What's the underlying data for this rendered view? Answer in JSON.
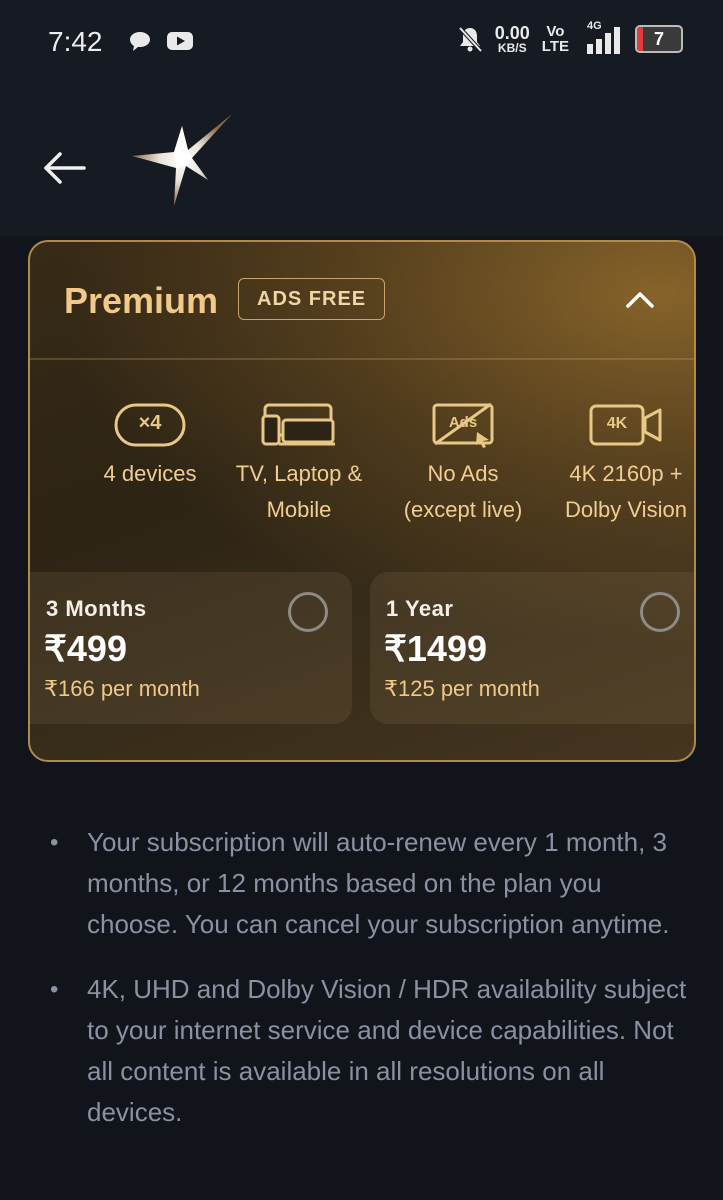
{
  "status_bar": {
    "time": "7:42",
    "net_speed": "0.00",
    "net_unit": "KB/S",
    "volte_top": "Vo",
    "volte_bottom": "LTE",
    "network": "4G",
    "battery": "7"
  },
  "plan": {
    "name": "Premium",
    "badge": "ADS FREE",
    "features": [
      {
        "icon": "devices-x4-icon",
        "icon_text": "×4",
        "label_line1": "4 devices",
        "label_line2": ""
      },
      {
        "icon": "tv-laptop-mobile-icon",
        "label_line1": "TV, Laptop &",
        "label_line2": "Mobile"
      },
      {
        "icon": "no-ads-icon",
        "icon_text": "Ads",
        "label_line1": "No Ads",
        "label_line2": "(except live)"
      },
      {
        "icon": "4k-camera-icon",
        "icon_text": "4K",
        "label_line1": "4K 2160p +",
        "label_line2": "Dolby Vision"
      }
    ],
    "options": [
      {
        "period": "3 Months",
        "price": "₹499",
        "per_month": "₹166 per month",
        "selected": false
      },
      {
        "period": "1 Year",
        "price": "₹1499",
        "per_month": "₹125 per month",
        "selected": false
      }
    ]
  },
  "notes": [
    "Your subscription will auto-renew every 1 month, 3 months, or 12 months based on the plan you choose. You can cancel your subscription anytime.",
    "4K, UHD and Dolby Vision / HDR availability subject to your internet service and device capabilities. Not all content is available in all resolutions on all devices."
  ],
  "colors": {
    "background": "#11141b",
    "card_border": "#b08a4d",
    "gold_text": "#f1c98a",
    "note_text": "#8b90a3"
  }
}
